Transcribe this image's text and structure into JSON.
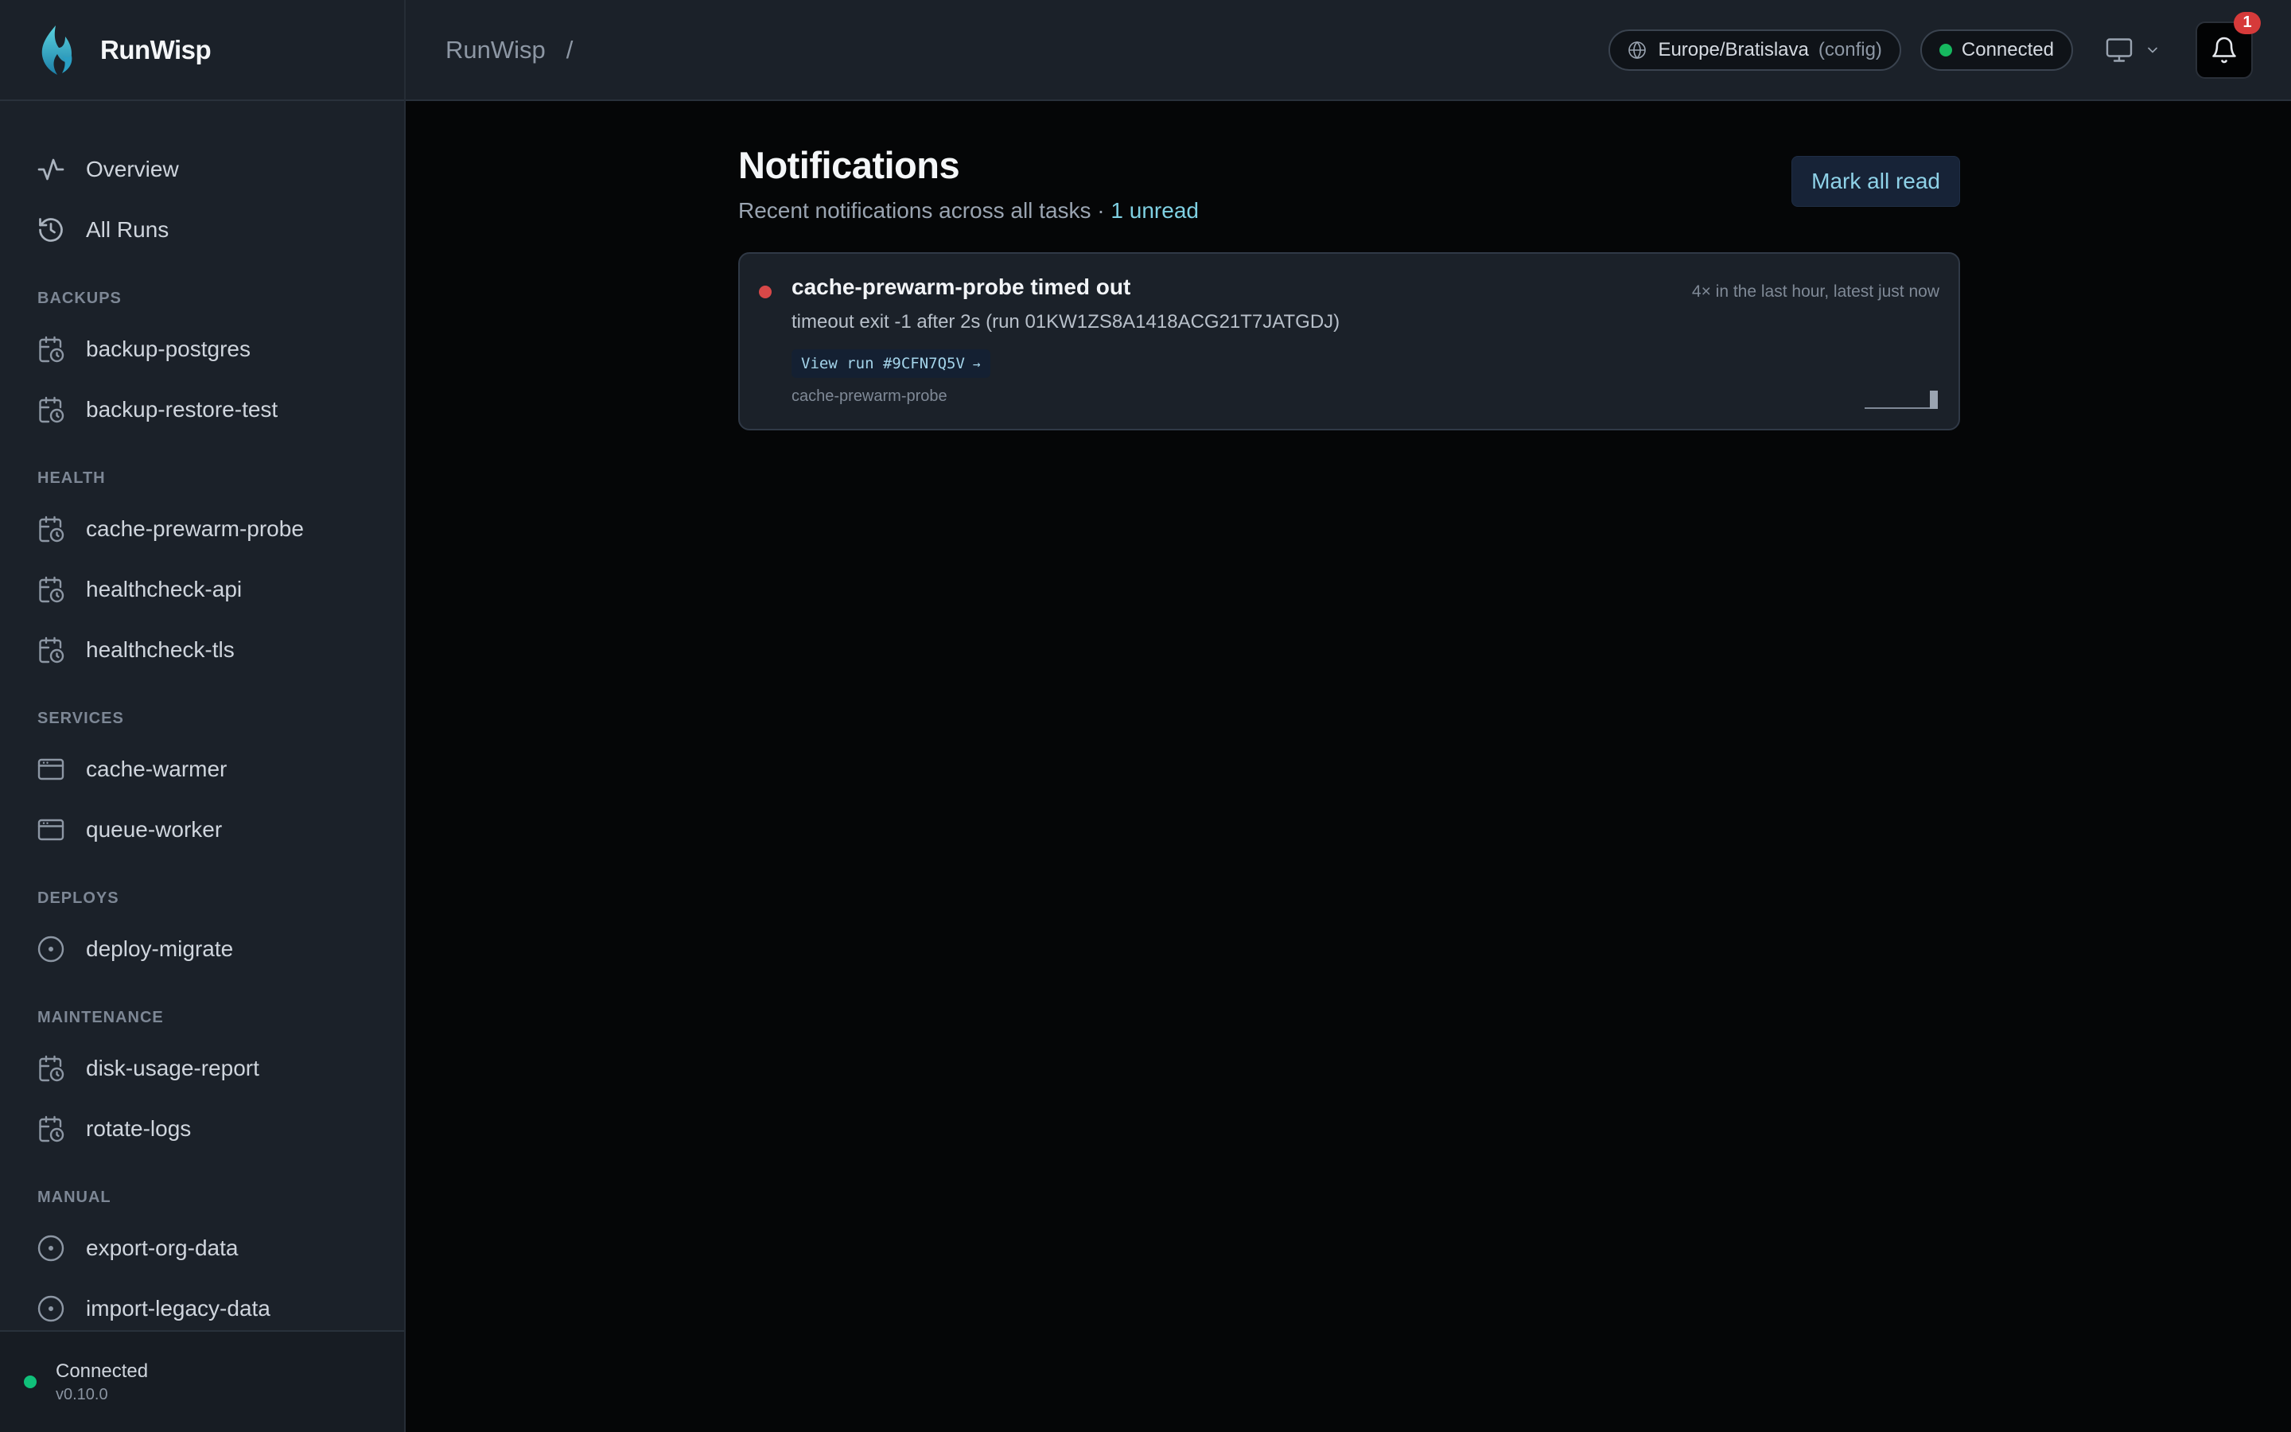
{
  "brand": {
    "name": "RunWisp"
  },
  "nav": {
    "top": [
      {
        "label": "Overview",
        "icon": "activity-icon"
      },
      {
        "label": "All Runs",
        "icon": "history-icon"
      }
    ],
    "sections": [
      {
        "label": "BACKUPS",
        "items": [
          {
            "label": "backup-postgres",
            "icon": "calendar-clock-icon"
          },
          {
            "label": "backup-restore-test",
            "icon": "calendar-clock-icon"
          }
        ]
      },
      {
        "label": "HEALTH",
        "items": [
          {
            "label": "cache-prewarm-probe",
            "icon": "calendar-clock-icon"
          },
          {
            "label": "healthcheck-api",
            "icon": "calendar-clock-icon"
          },
          {
            "label": "healthcheck-tls",
            "icon": "calendar-clock-icon"
          }
        ]
      },
      {
        "label": "SERVICES",
        "items": [
          {
            "label": "cache-warmer",
            "icon": "app-window-icon"
          },
          {
            "label": "queue-worker",
            "icon": "app-window-icon"
          }
        ]
      },
      {
        "label": "DEPLOYS",
        "items": [
          {
            "label": "deploy-migrate",
            "icon": "circle-dot-icon"
          }
        ]
      },
      {
        "label": "MAINTENANCE",
        "items": [
          {
            "label": "disk-usage-report",
            "icon": "calendar-clock-icon"
          },
          {
            "label": "rotate-logs",
            "icon": "calendar-clock-icon"
          }
        ]
      },
      {
        "label": "MANUAL",
        "items": [
          {
            "label": "export-org-data",
            "icon": "circle-dot-icon"
          },
          {
            "label": "import-legacy-data",
            "icon": "circle-dot-icon"
          }
        ]
      }
    ]
  },
  "footer": {
    "status": "Connected",
    "version": "v0.10.0",
    "status_color": "#10c07a"
  },
  "header": {
    "breadcrumb_root": "RunWisp",
    "breadcrumb_sep": "/",
    "timezone": "Europe/Bratislava",
    "timezone_source": "(config)",
    "connection": "Connected",
    "notification_count": "1"
  },
  "page": {
    "title": "Notifications",
    "subtitle": "Recent notifications across all tasks · ",
    "unread": "1 unread",
    "mark_all_read": "Mark all read"
  },
  "notifications": [
    {
      "title": "cache-prewarm-probe timed out",
      "time": "4× in the last hour, latest just now",
      "description": "timeout exit -1 after 2s (run 01KW1ZS8A1418ACG21T7JATGDJ)",
      "view_run": "View run #9CFN7Q5V",
      "view_run_arrow": "→",
      "task": "cache-prewarm-probe",
      "status_color": "#d84848"
    }
  ],
  "colors": {
    "accent": "#7fd0e2",
    "error": "#d84848",
    "success": "#16b85f"
  }
}
